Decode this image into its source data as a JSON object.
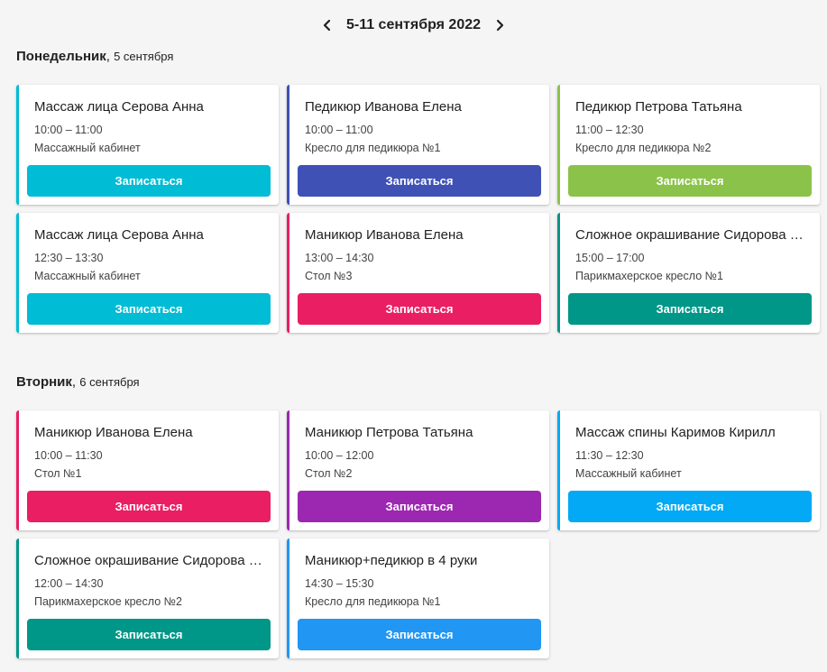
{
  "week_nav": {
    "range_label": "5-11 сентября 2022",
    "prev_icon": "chevron-left-icon",
    "next_icon": "chevron-right-icon"
  },
  "days": [
    {
      "name": "Понедельник",
      "date": "5 сентября",
      "cards": [
        {
          "title": "Массаж лица Серова Анна",
          "time": "10:00 – 11:00",
          "place": "Массажный кабинет",
          "button": "Записаться",
          "color": "#00bcd4"
        },
        {
          "title": "Педикюр Иванова Елена",
          "time": "10:00 – 11:00",
          "place": "Кресло для педикюра №1",
          "button": "Записаться",
          "color": "#3f51b5"
        },
        {
          "title": "Педикюр Петрова Татьяна",
          "time": "11:00 – 12:30",
          "place": "Кресло для педикюра №2",
          "button": "Записаться",
          "color": "#8bc34a"
        },
        {
          "title": "Массаж лица Серова Анна",
          "time": "12:30 – 13:30",
          "place": "Массажный кабинет",
          "button": "Записаться",
          "color": "#00bcd4"
        },
        {
          "title": "Маникюр Иванова Елена",
          "time": "13:00 – 14:30",
          "place": "Стол №3",
          "button": "Записаться",
          "color": "#e91e63"
        },
        {
          "title": "Сложное окрашивание Сидорова Ольга",
          "time": "15:00 – 17:00",
          "place": "Парикмахерское кресло №1",
          "button": "Записаться",
          "color": "#009688"
        }
      ]
    },
    {
      "name": "Вторник",
      "date": "6 сентября",
      "cards": [
        {
          "title": "Маникюр Иванова Елена",
          "time": "10:00 – 11:30",
          "place": "Стол №1",
          "button": "Записаться",
          "color": "#e91e63"
        },
        {
          "title": "Маникюр Петрова Татьяна",
          "time": "10:00 – 12:00",
          "place": "Стол №2",
          "button": "Записаться",
          "color": "#9c27b0"
        },
        {
          "title": "Массаж спины Каримов Кирилл",
          "time": "11:30 – 12:30",
          "place": "Массажный кабинет",
          "button": "Записаться",
          "color": "#03a9f4"
        },
        {
          "title": "Сложное окрашивание Сидорова Ольга",
          "time": "12:00 – 14:30",
          "place": "Парикмахерское кресло №2",
          "button": "Записаться",
          "color": "#009688"
        },
        {
          "title": "Маникюр+педикюр в 4 руки",
          "time": "14:30 – 15:30",
          "place": "Кресло для педикюра №1",
          "button": "Записаться",
          "color": "#2196f3"
        }
      ]
    }
  ]
}
